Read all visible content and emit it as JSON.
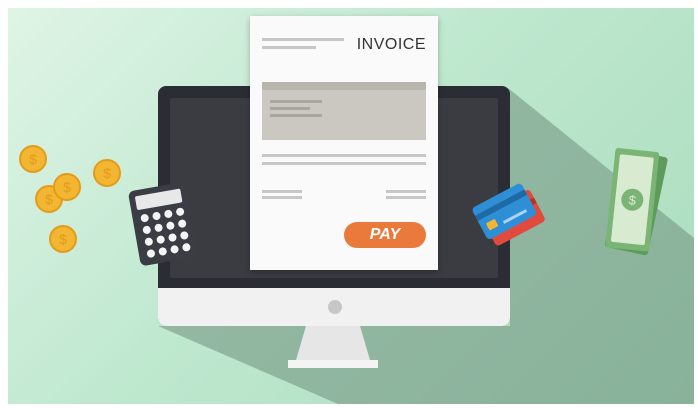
{
  "invoice": {
    "title": "INVOICE",
    "pay_label": "PAY"
  },
  "icons": {
    "coin": "dollar-coin-icon",
    "calculator": "calculator-icon",
    "cards": "credit-card-icon",
    "money": "banknote-icon",
    "coin_symbol": "$",
    "money_symbol": "$"
  },
  "colors": {
    "background": "#bfe8cf",
    "monitor": "#2a2d33",
    "pay_button": "#e97a3b",
    "coin": "#f2b632",
    "card_blue": "#2f8fd6",
    "card_red": "#e24a3d",
    "money": "#7bb575"
  }
}
